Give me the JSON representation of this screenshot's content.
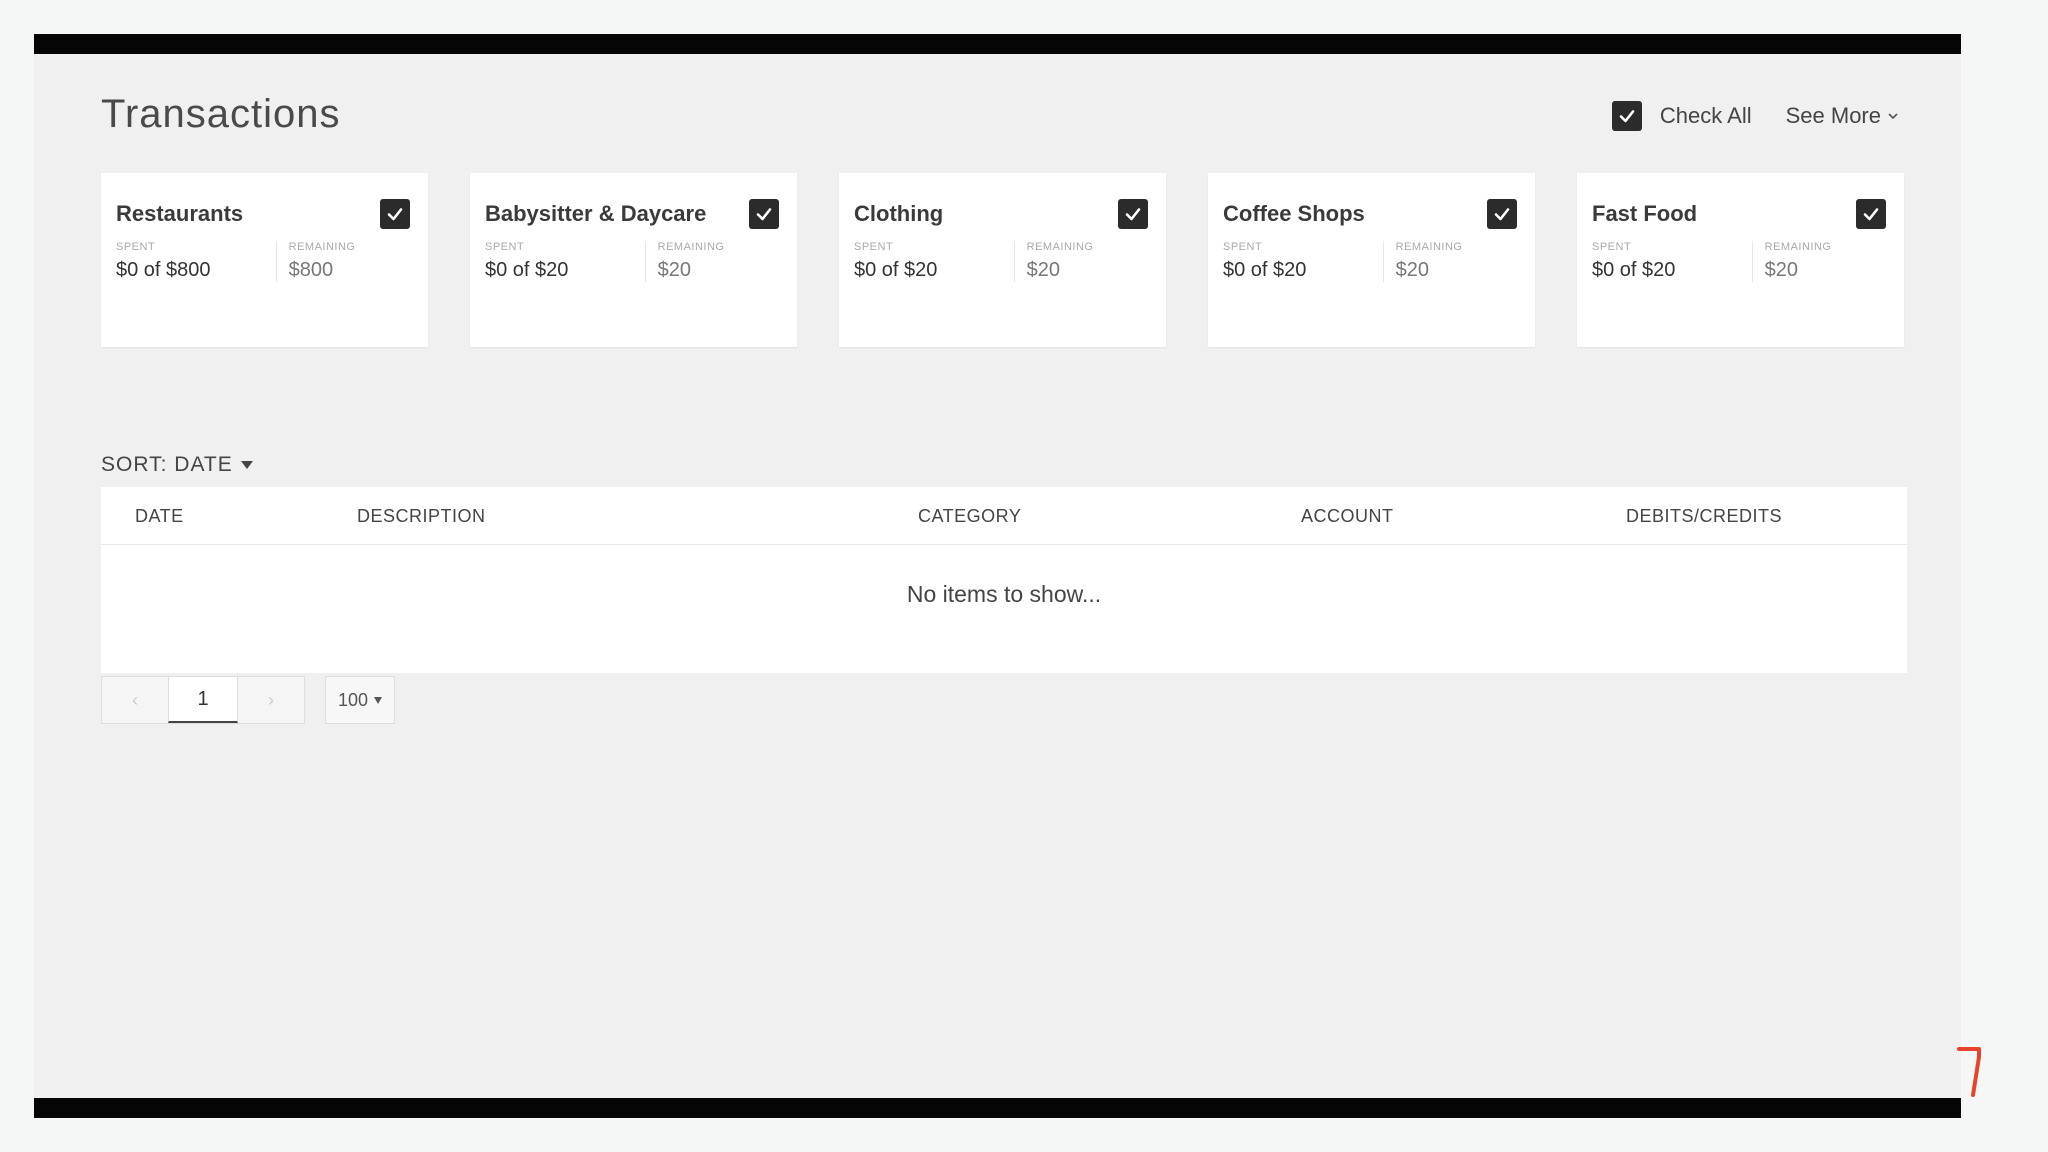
{
  "page": {
    "title": "Transactions"
  },
  "header": {
    "check_all_label": "Check All",
    "see_more_label": "See More"
  },
  "cards": [
    {
      "name": "Restaurants",
      "spent_label": "SPENT",
      "spent_value": "$0 of $800",
      "remaining_label": "REMAINING",
      "remaining_value": "$800",
      "checked": true
    },
    {
      "name": "Babysitter & Daycare",
      "spent_label": "SPENT",
      "spent_value": "$0 of $20",
      "remaining_label": "REMAINING",
      "remaining_value": "$20",
      "checked": true
    },
    {
      "name": "Clothing",
      "spent_label": "SPENT",
      "spent_value": "$0 of $20",
      "remaining_label": "REMAINING",
      "remaining_value": "$20",
      "checked": true
    },
    {
      "name": "Coffee Shops",
      "spent_label": "SPENT",
      "spent_value": "$0 of $20",
      "remaining_label": "REMAINING",
      "remaining_value": "$20",
      "checked": true
    },
    {
      "name": "Fast Food",
      "spent_label": "SPENT",
      "spent_value": "$0 of $20",
      "remaining_label": "REMAINING",
      "remaining_value": "$20",
      "checked": true
    }
  ],
  "sort": {
    "label": "SORT: DATE"
  },
  "table": {
    "columns": [
      "DATE",
      "DESCRIPTION",
      "CATEGORY",
      "ACCOUNT",
      "DEBITS/CREDITS"
    ],
    "empty_message": "No items to show..."
  },
  "pagination": {
    "prev_symbol": "‹",
    "current_page": "1",
    "next_symbol": "›",
    "per_page": "100"
  },
  "colors": {
    "accent_dark": "#2b2b2b",
    "corner_mark": "#e8432e"
  },
  "icons": {
    "checkbox": "check-icon",
    "see_more": "chevron-down-icon",
    "sort": "caret-down-icon"
  }
}
